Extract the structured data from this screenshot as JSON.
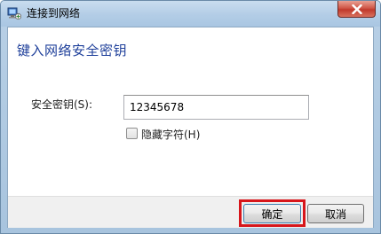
{
  "window": {
    "title": "连接到网络",
    "colors": {
      "heading": "#1e3f9a",
      "highlight": "#d7161b"
    }
  },
  "dialog": {
    "heading": "键入网络安全密钥",
    "key_label": "安全密钥(S):",
    "key_value": "12345678",
    "hide_chars_label": "隐藏字符(H)",
    "hide_chars_checked": false
  },
  "buttons": {
    "ok_label": "确定",
    "cancel_label": "取消"
  },
  "icons": [
    "network-icon",
    "close-icon"
  ]
}
